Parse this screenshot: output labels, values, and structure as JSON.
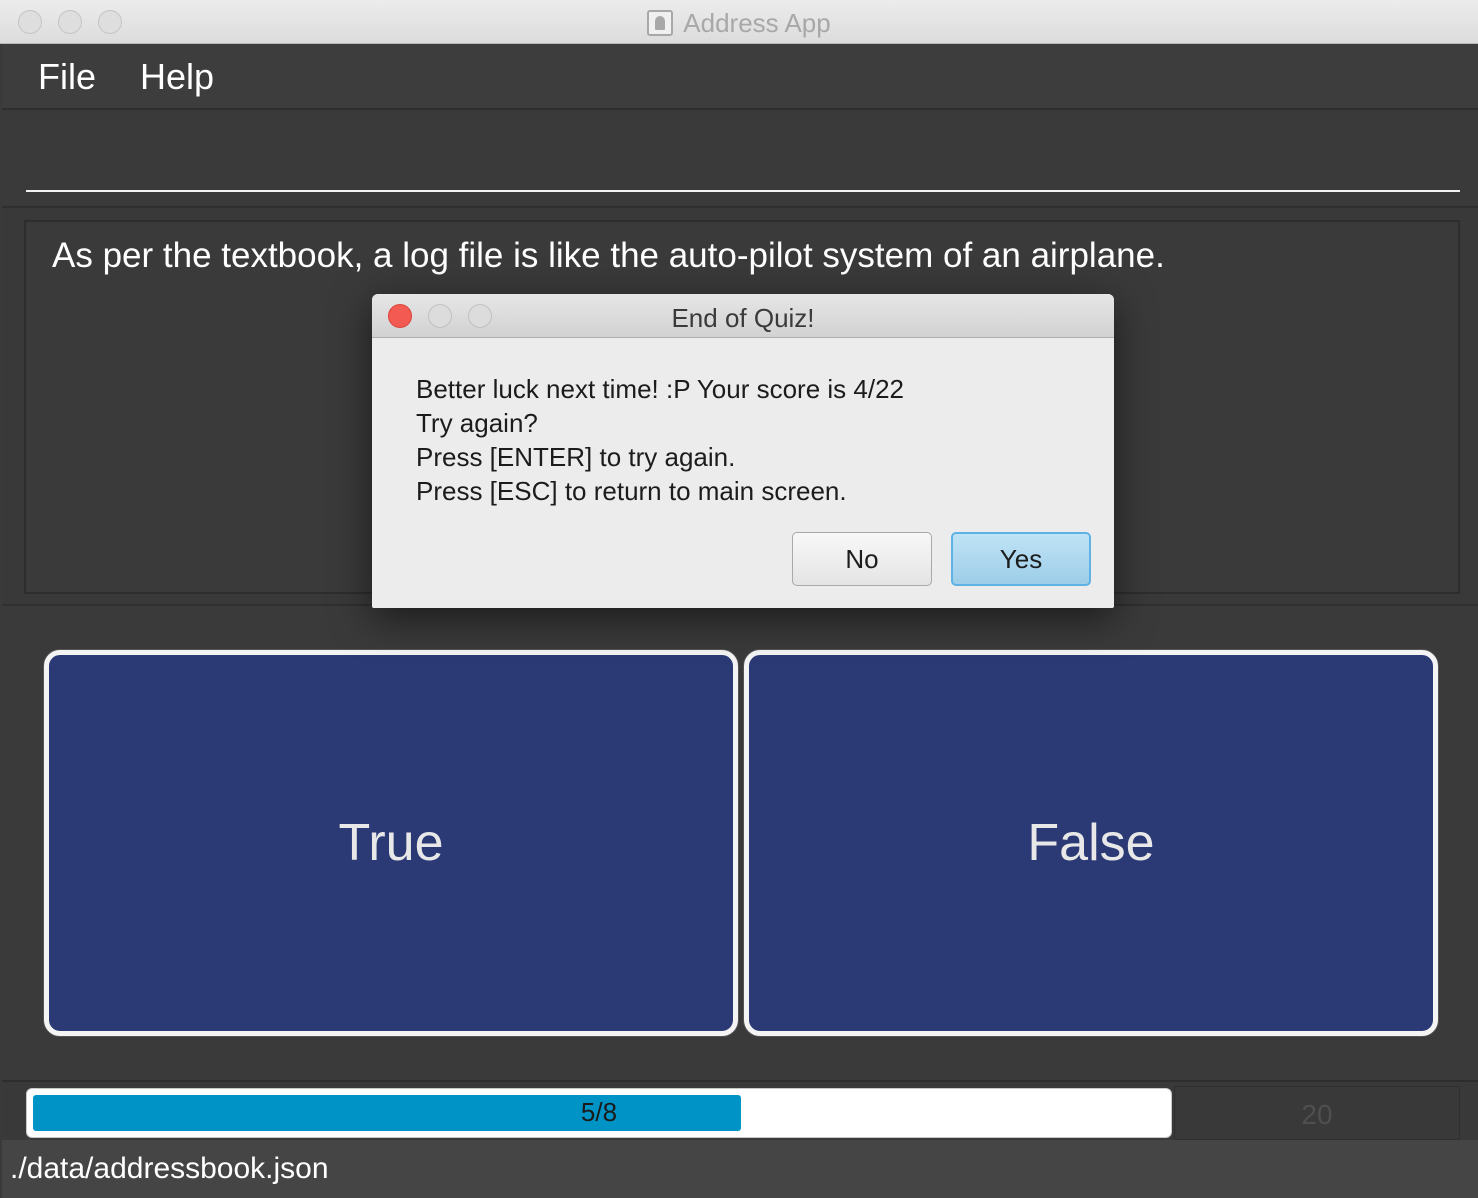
{
  "window": {
    "title": "Address App",
    "title_icon": "contacts-app-icon"
  },
  "menu": {
    "file": "File",
    "help": "Help"
  },
  "command_box": {
    "value": ""
  },
  "question": {
    "text": "As per the textbook, a log file is like the auto-pilot system of an airplane."
  },
  "answers": {
    "true_label": "True",
    "false_label": "False"
  },
  "progress": {
    "label": "5/8",
    "fraction": 0.625,
    "fill_color": "#0094c6"
  },
  "timer": {
    "value": "20"
  },
  "status": {
    "path": "./data/addressbook.json"
  },
  "dialog": {
    "title": "End of Quiz!",
    "lines": [
      "Better luck next time! :P Your score is 4/22",
      "Try again?",
      "Press [ENTER] to try again.",
      "Press [ESC] to return to main screen."
    ],
    "no_label": "No",
    "yes_label": "Yes"
  },
  "colors": {
    "background": "#3a3a3a",
    "answer_button": "#2b3a75",
    "close_red": "#f25a52",
    "default_button": "#9dcde8"
  }
}
